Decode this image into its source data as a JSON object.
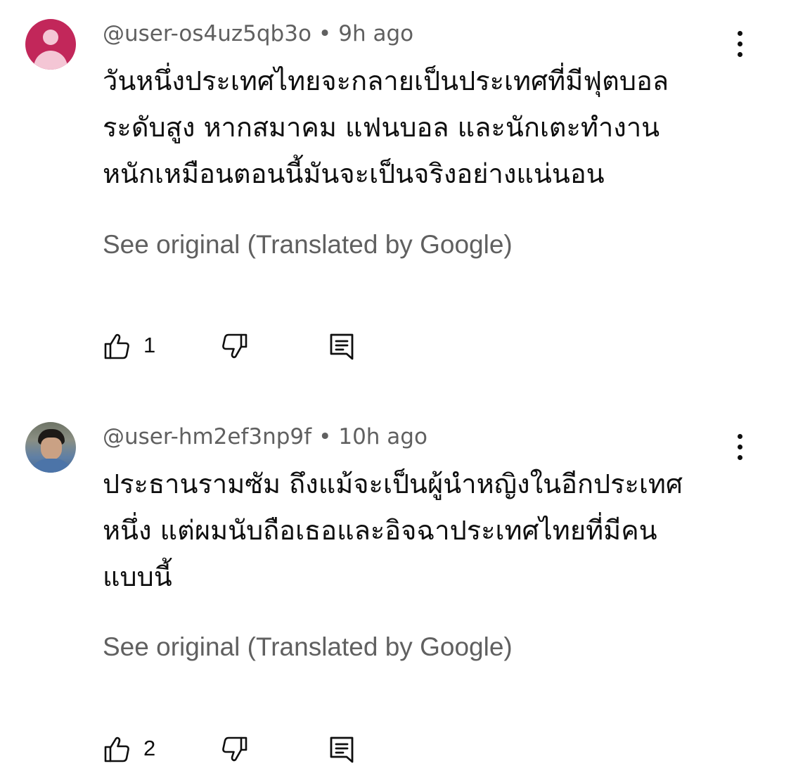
{
  "comments": [
    {
      "username": "@user-os4uz5qb3o",
      "time": "9h ago",
      "text_lines": [
        "วันหนึ่งประเทศไทยจะกลายเป็นประเทศที่มีฟุตบอล",
        "ระดับสูง หากสมาคม แฟนบอล และนักเตะทำงาน",
        "หนักเหมือนตอนนี้มันจะเป็นจริงอย่างแน่นอน"
      ],
      "see_original": "See original (Translated by Google)",
      "likes": "1",
      "avatar": "default-avatar-icon"
    },
    {
      "username": "@user-hm2ef3np9f",
      "time": "10h ago",
      "text_lines": [
        "ประธานรามซัม ถึงแม้จะเป็นผู้นำหญิงในอีกประเทศ",
        "หนึ่ง แต่ผมนับถือเธอและอิจฉาประเทศไทยที่มีคน",
        "แบบนี้"
      ],
      "see_original": "See original (Translated by Google)",
      "likes": "2",
      "avatar": "photo-avatar"
    }
  ],
  "colors": {
    "text": "#0f0f0f",
    "secondary": "#606060",
    "avatar_default_bg": "#c2275a",
    "background": "#ffffff"
  },
  "separator": "•"
}
